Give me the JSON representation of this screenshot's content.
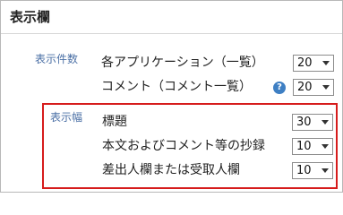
{
  "section": {
    "title": "表示欄"
  },
  "display_count": {
    "group_label": "表示件数",
    "rows": [
      {
        "label": "各アプリケーション（一覧）",
        "value": "20"
      },
      {
        "label": "コメント（コメント一覧）",
        "value": "20",
        "help_icon": "help-icon",
        "help_glyph": "?"
      }
    ]
  },
  "display_width": {
    "group_label": "表示幅",
    "rows": [
      {
        "label": "標題",
        "value": "30"
      },
      {
        "label": "本文およびコメント等の抄録",
        "value": "10"
      },
      {
        "label": "差出人欄または受取人欄",
        "value": "10"
      }
    ]
  },
  "colors": {
    "group_label": "#4a6fa5",
    "highlight_border": "#d61c1c",
    "help_icon": "#3e7fc3"
  }
}
